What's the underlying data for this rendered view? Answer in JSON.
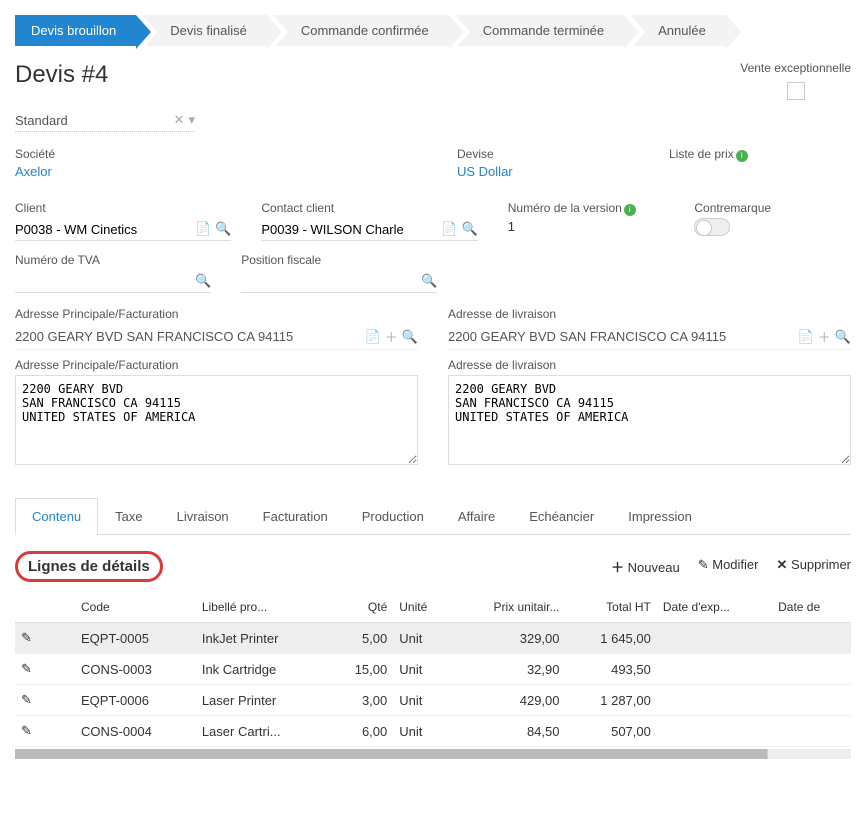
{
  "steps": [
    "Devis brouillon",
    "Devis finalisé",
    "Commande confirmée",
    "Commande terminée",
    "Annulée"
  ],
  "title": "Devis #4",
  "standard": {
    "label": "Standard"
  },
  "vente_ex": {
    "label": "Vente exceptionnelle"
  },
  "societe": {
    "label": "Société",
    "value": "Axelor"
  },
  "devise": {
    "label": "Devise",
    "value": "US Dollar"
  },
  "prix": {
    "label": "Liste de prix"
  },
  "client": {
    "label": "Client",
    "value": "P0038 - WM Cinetics"
  },
  "contact": {
    "label": "Contact client",
    "value": "P0039 - WILSON Charle"
  },
  "version": {
    "label": "Numéro de la version",
    "value": "1"
  },
  "contremarque": {
    "label": "Contremarque"
  },
  "tva": {
    "label": "Numéro de TVA"
  },
  "fiscale": {
    "label": "Position fiscale"
  },
  "addr_fact": {
    "label": "Adresse Principale/Facturation",
    "line": "2200 GEARY BVD SAN FRANCISCO CA 94115",
    "block": "2200 GEARY BVD\nSAN FRANCISCO CA 94115\nUNITED STATES OF AMERICA"
  },
  "addr_liv": {
    "label": "Adresse de livraison",
    "line": "2200 GEARY BVD SAN FRANCISCO CA 94115",
    "block": "2200 GEARY BVD\nSAN FRANCISCO CA 94115\nUNITED STATES OF AMERICA"
  },
  "tabs": [
    "Contenu",
    "Taxe",
    "Livraison",
    "Facturation",
    "Production",
    "Affaire",
    "Echéancier",
    "Impression"
  ],
  "section_title": "Lignes de détails",
  "actions": {
    "new": "Nouveau",
    "edit": "Modifier",
    "delete": "Supprimer"
  },
  "cols": {
    "code": "Code",
    "libelle": "Libellé pro...",
    "qte": "Qté",
    "unite": "Unité",
    "prix": "Prix unitair...",
    "total": "Total HT",
    "exp": "Date d'exp...",
    "date": "Date de"
  },
  "rows": [
    {
      "code": "EQPT-0005",
      "lib": "InkJet Printer",
      "qte": "5,00",
      "unite": "Unit",
      "prix": "329,00",
      "total": "1 645,00"
    },
    {
      "code": "CONS-0003",
      "lib": "Ink Cartridge",
      "qte": "15,00",
      "unite": "Unit",
      "prix": "32,90",
      "total": "493,50"
    },
    {
      "code": "EQPT-0006",
      "lib": "Laser Printer",
      "qte": "3,00",
      "unite": "Unit",
      "prix": "429,00",
      "total": "1 287,00"
    },
    {
      "code": "CONS-0004",
      "lib": "Laser Cartri...",
      "qte": "6,00",
      "unite": "Unit",
      "prix": "84,50",
      "total": "507,00"
    }
  ]
}
